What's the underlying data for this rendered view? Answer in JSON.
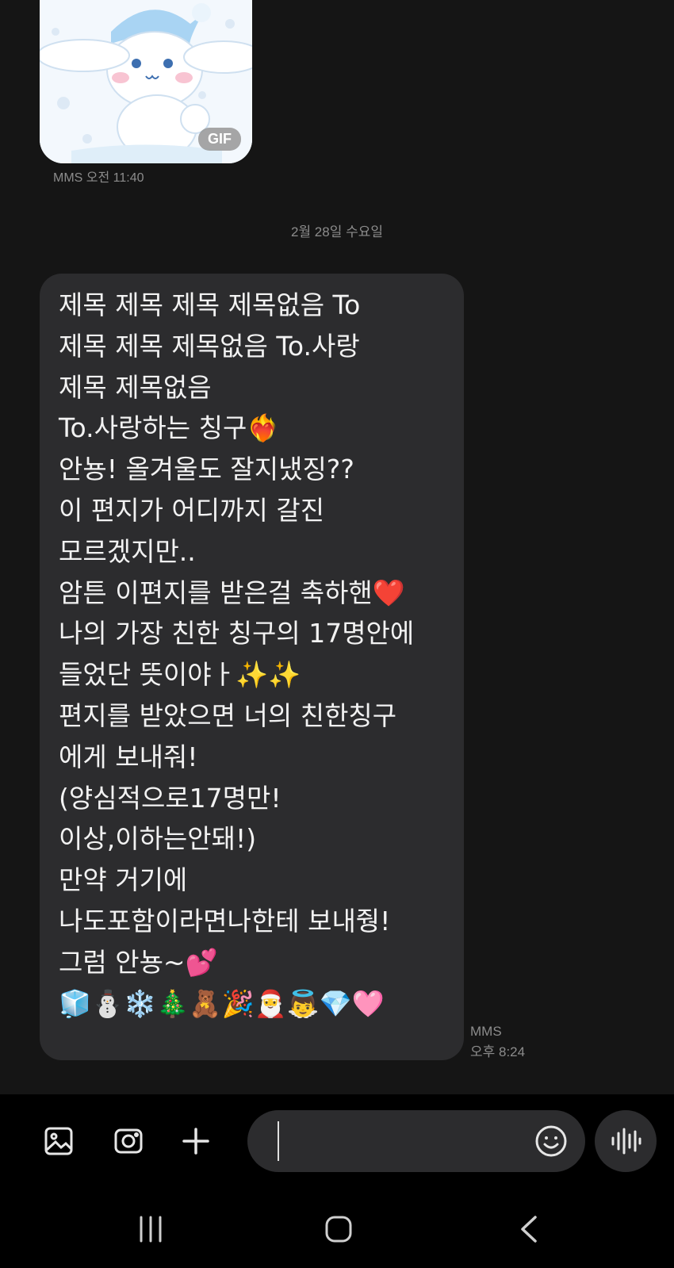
{
  "gif_message": {
    "badge": "GIF",
    "meta": "MMS 오전 11:40"
  },
  "date_separator": "2월 28일 수요일",
  "message": {
    "lines": [
      "제목 제목 제목 제목없음 To",
      "제목 제목 제목없음 To.사랑",
      "제목 제목없음",
      "To.사랑하는 칭구❤️‍🔥",
      "안뇽! 올겨울도 잘지냈징??",
      "이 편지가 어디까지 갈진",
      "모르겠지만..",
      "암튼 이편지를 받은걸 축하핸❤️",
      "나의 가장 친한 칭구의 17명안에",
      "들었단 뜻이야ㅏ✨✨",
      "편지를 받았으면 너의 친한칭구",
      "에게 보내줘!",
      "(양심적으로17명만!",
      "이상,이하는안돼!)",
      "만약 거기에",
      "나도포함이라면나한테 보내줭!",
      "그럼 안뇽~💕",
      "🧊⛄❄️🎄🧸🎉🎅👼💎🩷"
    ],
    "meta_type": "MMS",
    "meta_time": "오후 8:24"
  },
  "composer": {
    "gallery_icon": "gallery-icon",
    "camera_icon": "camera-icon",
    "plus_icon": "plus-icon",
    "emoji_icon": "emoji-icon",
    "voice_icon": "voice-icon"
  },
  "navbar": {
    "recent_icon": "recent-apps-icon",
    "home_icon": "home-icon",
    "back_icon": "back-icon"
  }
}
